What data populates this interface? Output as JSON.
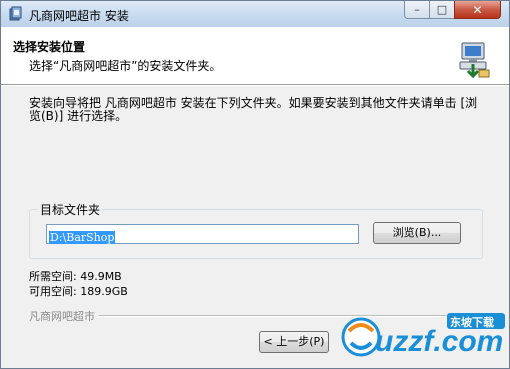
{
  "window": {
    "title": "凡商网吧超市 安装",
    "controls": {
      "minimize": "–",
      "maximize": "□",
      "close": "✕"
    }
  },
  "header": {
    "title": "选择安装位置",
    "subtitle": "选择“凡商网吧超市”的安装文件夹。"
  },
  "body": {
    "description": "安装向导将把 凡商网吧超市 安装在下列文件夹。如果要安装到其他文件夹请单击 [浏览(B)] 进行选择。",
    "target_group_label": "目标文件夹",
    "install_path": "D:\\BarShop",
    "browse_label": "浏览(B)...",
    "space_required": "所需空间: 49.9MB",
    "space_available": "可用空间: 189.9GB",
    "brand": "凡商网吧超市"
  },
  "footer": {
    "back_label": "< 上一步(P)"
  },
  "watermark": {
    "logo_text": "uzzf.com",
    "badge_text": "东坡下载"
  },
  "colors": {
    "title_bar": "#c9dcf0",
    "selection": "#3399ff",
    "close_button": "#c85a45",
    "watermark_blue": "#1a8fd8",
    "watermark_orange": "#f08a1a"
  }
}
